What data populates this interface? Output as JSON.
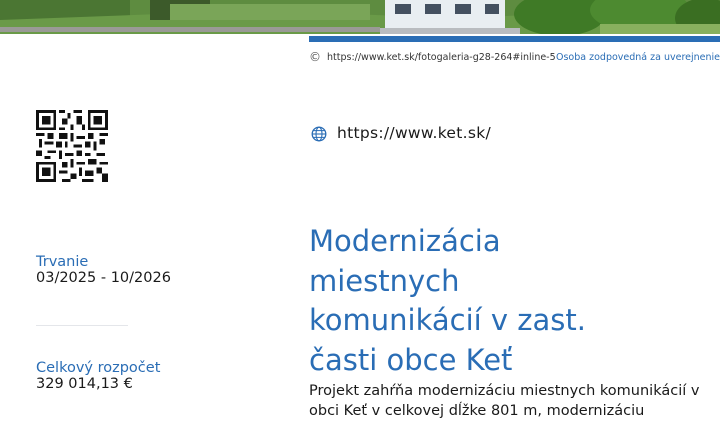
{
  "photo": {
    "subject": "aerial-photo-strip"
  },
  "credit": {
    "copyright_symbol": "©",
    "source_url": "https://www.ket.sk/fotogaleria-g28-264#inline-5",
    "responsible_person": "Osoba zodpovedná za uverejnenie"
  },
  "website": {
    "icon": "globe-icon",
    "url": "https://www.ket.sk/"
  },
  "qr": {
    "icon": "qr-code"
  },
  "duration": {
    "label": "Trvanie",
    "value": "03/2025 - 10/2026"
  },
  "budget": {
    "label": "Celkový rozpočet",
    "value": "329 014,13 €"
  },
  "project": {
    "title_lines": [
      "Modernizácia",
      "miestnych",
      "komunikácií v zast.",
      "časti obce Keť"
    ],
    "description": "Projekt zahŕňa modernizáciu miestnych komunikácií v obci Keť v celkovej dĺžke 801 m, modernizáciu"
  },
  "colors": {
    "accent": "#2a6db5",
    "text": "#1a1a1a"
  }
}
